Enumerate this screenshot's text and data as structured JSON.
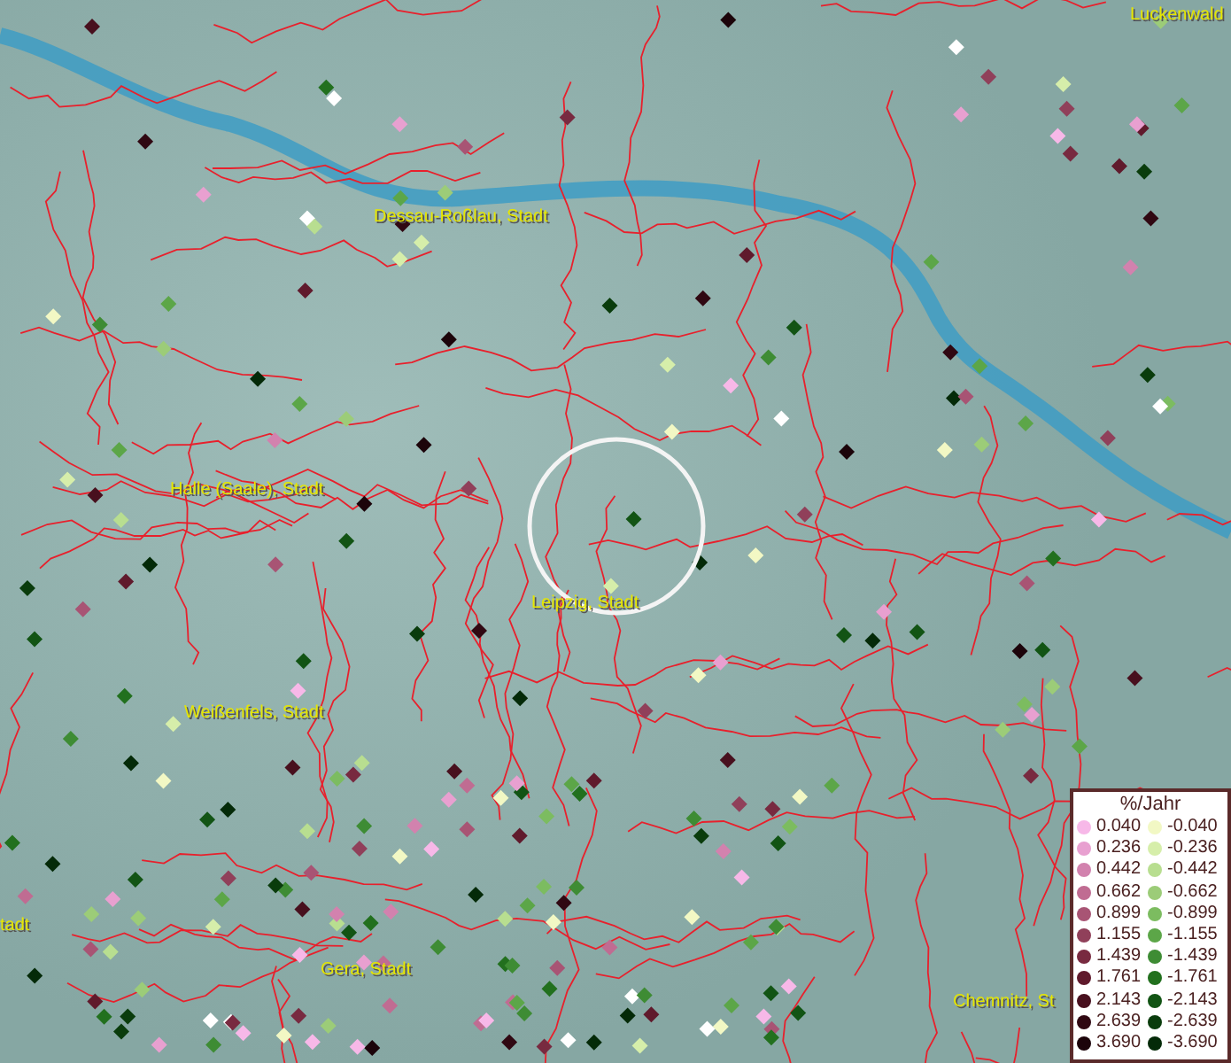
{
  "map": {
    "place_labels": [
      {
        "text": "Luckenwald"
      },
      {
        "text": "Dessau-Roßlau, Stadt"
      },
      {
        "text": "Halle (Saale), Stadt"
      },
      {
        "text": "Leipzig, Stadt"
      },
      {
        "text": "Weißenfels, Stadt"
      },
      {
        "text": "tadt"
      },
      {
        "text": "Gera, Stadt"
      },
      {
        "text": "Chemnitz, St"
      }
    ]
  },
  "legend": {
    "title": "%/Jahr",
    "rows": [
      {
        "positive": {
          "label": "0.040",
          "color": "#f7b8e8"
        },
        "negative": {
          "label": "-0.040",
          "color": "#f2f8c4"
        }
      },
      {
        "positive": {
          "label": "0.236",
          "color": "#e8a0d0"
        },
        "negative": {
          "label": "-0.236",
          "color": "#d6eeaa"
        }
      },
      {
        "positive": {
          "label": "0.442",
          "color": "#d282ae"
        },
        "negative": {
          "label": "-0.442",
          "color": "#b8de90"
        }
      },
      {
        "positive": {
          "label": "0.662",
          "color": "#c06c92"
        },
        "negative": {
          "label": "-0.662",
          "color": "#9ccc78"
        }
      },
      {
        "positive": {
          "label": "0.899",
          "color": "#a85474"
        },
        "negative": {
          "label": "-0.899",
          "color": "#7cbc60"
        }
      },
      {
        "positive": {
          "label": "1.155",
          "color": "#90405a"
        },
        "negative": {
          "label": "-1.155",
          "color": "#5ca648"
        }
      },
      {
        "positive": {
          "label": "1.439",
          "color": "#782a40"
        },
        "negative": {
          "label": "-1.439",
          "color": "#3e8c34"
        }
      },
      {
        "positive": {
          "label": "1.761",
          "color": "#601a2c"
        },
        "negative": {
          "label": "-1.761",
          "color": "#22701e"
        }
      },
      {
        "positive": {
          "label": "2.143",
          "color": "#48101e"
        },
        "negative": {
          "label": "-2.143",
          "color": "#125414"
        }
      },
      {
        "positive": {
          "label": "2.639",
          "color": "#300812"
        },
        "negative": {
          "label": "-2.639",
          "color": "#0a3c0c"
        }
      },
      {
        "positive": {
          "label": "3.690",
          "color": "#1c040a"
        },
        "negative": {
          "label": "-3.690",
          "color": "#042a08"
        }
      }
    ]
  }
}
